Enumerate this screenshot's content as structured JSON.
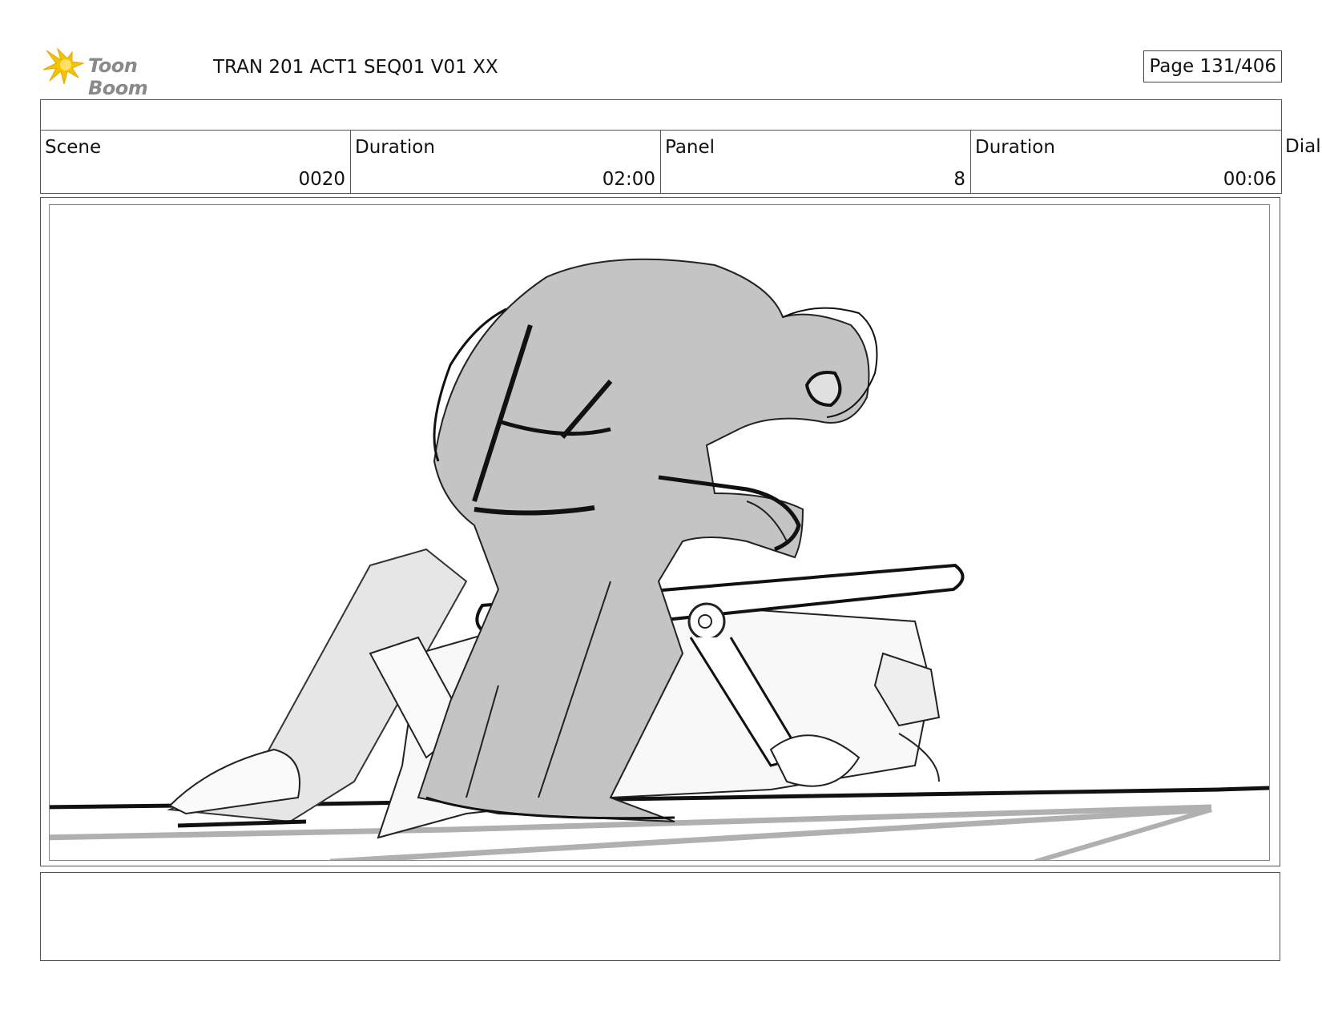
{
  "header": {
    "logo_text": "Toon Boom",
    "title": "TRAN 201 ACT1 SEQ01 V01 XX",
    "page_label": "Page 131/406"
  },
  "info": {
    "scene_label": "Scene",
    "scene_value": "0020",
    "scene_duration_label": "Duration",
    "scene_duration_value": "02:00",
    "panel_label": "Panel",
    "panel_value": "8",
    "panel_duration_label": "Duration",
    "panel_duration_value": "00:06",
    "dialog_label": "Dialo"
  },
  "colors": {
    "logo_yellow": "#f5c400",
    "sketch_gray": "#c4c4c4",
    "sketch_light": "#e6e6e6",
    "ink": "#111111"
  }
}
